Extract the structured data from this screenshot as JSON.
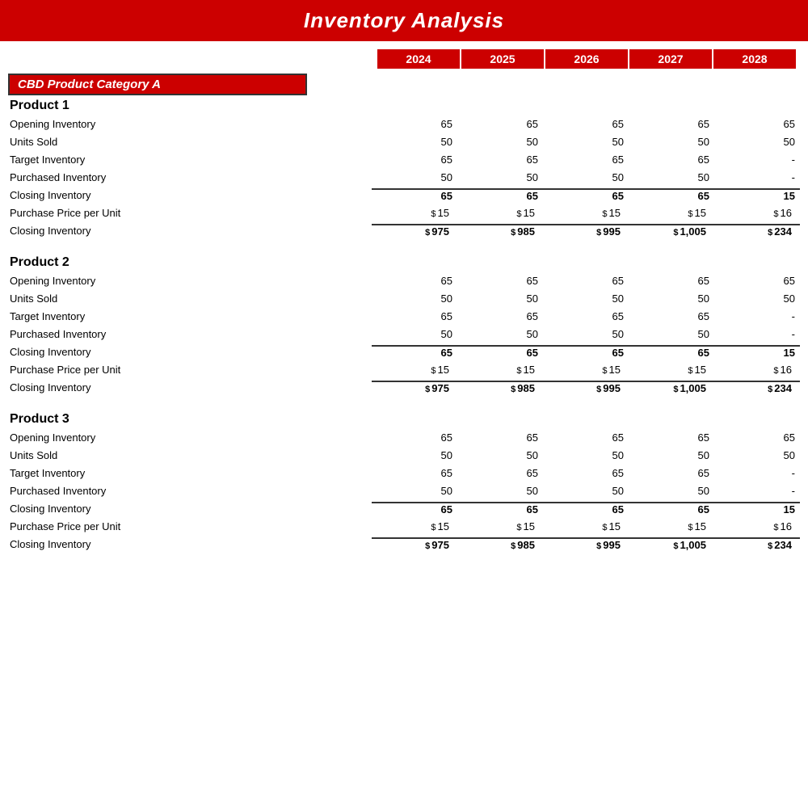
{
  "header": {
    "title": "Inventory Analysis"
  },
  "years": [
    "2024",
    "2025",
    "2026",
    "2027",
    "2028"
  ],
  "category": "CBD Product Category A",
  "products": [
    {
      "name": "Product 1",
      "rows": [
        {
          "label": "Opening Inventory",
          "values": [
            "",
            "65",
            "65",
            "65",
            "65",
            "65"
          ],
          "type": "normal"
        },
        {
          "label": "Units Sold",
          "values": [
            "",
            "50",
            "50",
            "50",
            "50",
            "50"
          ],
          "type": "normal"
        },
        {
          "label": "Target Inventory",
          "values": [
            "",
            "65",
            "65",
            "65",
            "65",
            "-"
          ],
          "type": "normal"
        },
        {
          "label": "Purchased Inventory",
          "values": [
            "",
            "50",
            "50",
            "50",
            "50",
            "-"
          ],
          "type": "normal"
        },
        {
          "label": "Closing Inventory",
          "values": [
            "",
            "65",
            "65",
            "65",
            "65",
            "15"
          ],
          "type": "closing-inv"
        },
        {
          "label": "Purchase Price per Unit",
          "values": [
            "$",
            "15",
            "$",
            "15",
            "$",
            "15",
            "$",
            "15",
            "$",
            "16"
          ],
          "type": "price"
        },
        {
          "label": "Closing Inventory",
          "values": [
            "$",
            "975",
            "$",
            "985",
            "$",
            "995",
            "$",
            "1,005",
            "$",
            "234"
          ],
          "type": "closing-dollar"
        }
      ]
    },
    {
      "name": "Product 2",
      "rows": [
        {
          "label": "Opening Inventory",
          "values": [
            "",
            "65",
            "65",
            "65",
            "65",
            "65"
          ],
          "type": "normal"
        },
        {
          "label": "Units Sold",
          "values": [
            "",
            "50",
            "50",
            "50",
            "50",
            "50"
          ],
          "type": "normal"
        },
        {
          "label": "Target Inventory",
          "values": [
            "",
            "65",
            "65",
            "65",
            "65",
            "-"
          ],
          "type": "normal"
        },
        {
          "label": "Purchased Inventory",
          "values": [
            "",
            "50",
            "50",
            "50",
            "50",
            "-"
          ],
          "type": "normal"
        },
        {
          "label": "Closing Inventory",
          "values": [
            "",
            "65",
            "65",
            "65",
            "65",
            "15"
          ],
          "type": "closing-inv"
        },
        {
          "label": "Purchase Price per Unit",
          "values": [
            "$",
            "15",
            "$",
            "15",
            "$",
            "15",
            "$",
            "15",
            "$",
            "16"
          ],
          "type": "price"
        },
        {
          "label": "Closing Inventory",
          "values": [
            "$",
            "975",
            "$",
            "985",
            "$",
            "995",
            "$",
            "1,005",
            "$",
            "234"
          ],
          "type": "closing-dollar"
        }
      ]
    },
    {
      "name": "Product 3",
      "rows": [
        {
          "label": "Opening Inventory",
          "values": [
            "",
            "65",
            "65",
            "65",
            "65",
            "65"
          ],
          "type": "normal"
        },
        {
          "label": "Units Sold",
          "values": [
            "",
            "50",
            "50",
            "50",
            "50",
            "50"
          ],
          "type": "normal"
        },
        {
          "label": "Target Inventory",
          "values": [
            "",
            "65",
            "65",
            "65",
            "65",
            "-"
          ],
          "type": "normal"
        },
        {
          "label": "Purchased Inventory",
          "values": [
            "",
            "50",
            "50",
            "50",
            "50",
            "-"
          ],
          "type": "normal"
        },
        {
          "label": "Closing Inventory",
          "values": [
            "",
            "65",
            "65",
            "65",
            "65",
            "15"
          ],
          "type": "closing-inv"
        },
        {
          "label": "Purchase Price per Unit",
          "values": [
            "$",
            "15",
            "$",
            "15",
            "$",
            "15",
            "$",
            "15",
            "$",
            "16"
          ],
          "type": "price"
        },
        {
          "label": "Closing Inventory",
          "values": [
            "$",
            "975",
            "$",
            "985",
            "$",
            "995",
            "$",
            "1,005",
            "$",
            "234"
          ],
          "type": "closing-dollar"
        }
      ]
    }
  ]
}
